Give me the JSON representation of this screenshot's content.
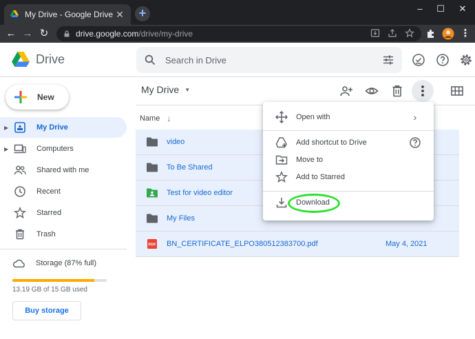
{
  "browser": {
    "tab_title": "My Drive - Google Drive",
    "tab_close": "✕",
    "new_tab": "+",
    "window_controls": {
      "minimize": "–",
      "maximize": "☐",
      "close": "✕"
    },
    "nav": {
      "back": "←",
      "forward": "→",
      "reload": "↻"
    },
    "url_host": "drive.google.com",
    "url_path": "/drive/my-drive"
  },
  "header": {
    "app_name": "Drive",
    "search_placeholder": "Search in Drive"
  },
  "sidebar": {
    "new_label": "New",
    "items": [
      {
        "label": "My Drive",
        "icon": "my-drive-icon",
        "active": true
      },
      {
        "label": "Computers",
        "icon": "computers-icon"
      },
      {
        "label": "Shared with me",
        "icon": "shared-icon"
      },
      {
        "label": "Recent",
        "icon": "clock-icon"
      },
      {
        "label": "Starred",
        "icon": "star-icon"
      },
      {
        "label": "Trash",
        "icon": "trash-icon"
      }
    ],
    "storage_label": "Storage (87% full)",
    "storage_percent": 87,
    "storage_used": "13.19 GB of 15 GB used",
    "buy_storage": "Buy storage"
  },
  "main": {
    "title": "My Drive",
    "column_name": "Name",
    "sort_arrow": "↓",
    "files": [
      {
        "name": "video",
        "type": "folder",
        "date": ""
      },
      {
        "name": "To Be Shared",
        "type": "folder",
        "date": ""
      },
      {
        "name": "Test for video editor",
        "type": "shared-folder",
        "date": ""
      },
      {
        "name": "My Files",
        "type": "folder",
        "date": ""
      },
      {
        "name": "BN_CERTIFICATE_ELPO380512383700.pdf",
        "type": "pdf",
        "date": "May 4, 2021"
      }
    ]
  },
  "context_menu": {
    "open_with": "Open with",
    "open_with_arrow": "›",
    "add_shortcut": "Add shortcut to Drive",
    "move_to": "Move to",
    "add_starred": "Add to Starred",
    "download": "Download"
  },
  "colors": {
    "accent": "#1a73e8",
    "selection": "#e8f0fe",
    "storage_fill": "#f9ab00",
    "highlight_ring": "#2ee02e"
  }
}
